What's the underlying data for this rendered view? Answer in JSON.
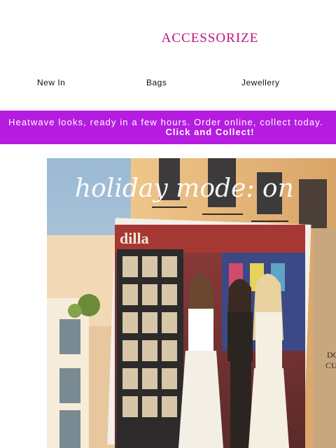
{
  "brand": {
    "logo_text": "ACCESSORIZE",
    "color": "#c2127f"
  },
  "nav": {
    "items": [
      "New In",
      "Bags",
      "Jewellery"
    ]
  },
  "banner": {
    "line1": "Heatwave looks, ready in a few hours. Order online, collect today.",
    "line2": "Click and Collect!",
    "background": "#b51ce0"
  },
  "hero": {
    "headline": "holiday mode: on",
    "storefront_sign": "dilla",
    "sign_text_right": "DO",
    "sign_text_right2": "CUO"
  }
}
